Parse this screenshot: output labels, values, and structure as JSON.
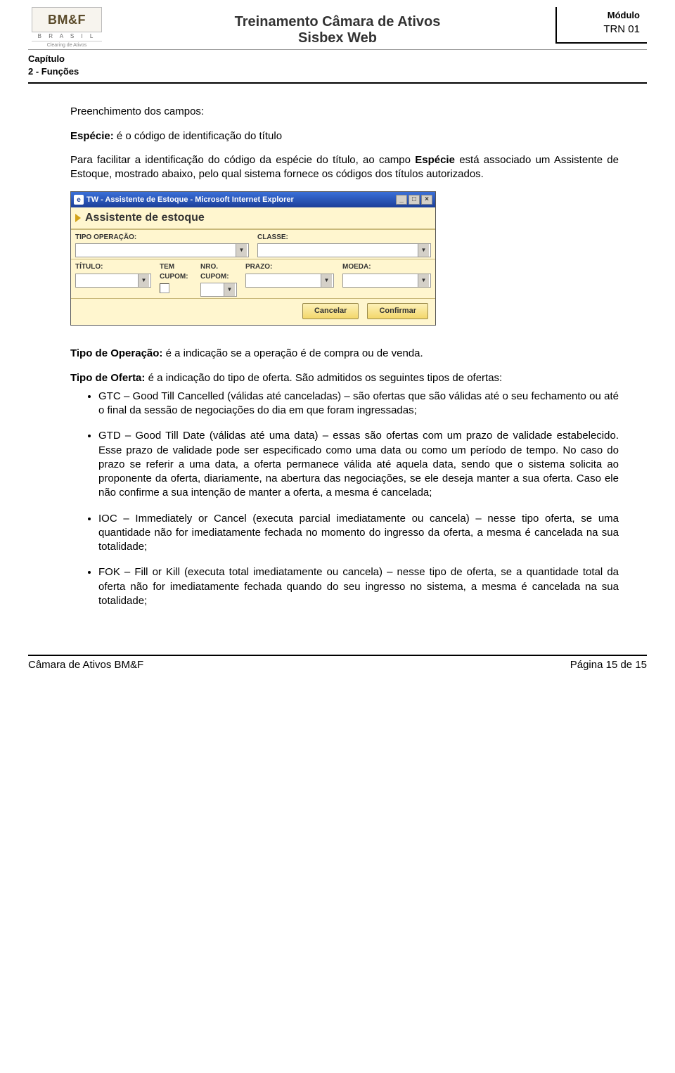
{
  "header": {
    "logo_main": "BM&F",
    "logo_country": "B R A S I L",
    "logo_sub": "Clearing de Ativos",
    "title_line1": "Treinamento Câmara de Ativos",
    "title_line2": "Sisbex Web",
    "modulo_label": "Módulo",
    "modulo_code": "TRN 01",
    "capitulo_label": "Capítulo",
    "capitulo_value": "2 - Funções"
  },
  "body": {
    "p1": "Preenchimento dos campos:",
    "especie_label": "Espécie:",
    "especie_text": " é o código de identificação do título",
    "p2_pre": "Para facilitar a identificação do código da espécie do título, ao campo ",
    "p2_bold": "Espécie",
    "p2_post": " está associado um Assistente de Estoque, mostrado abaixo, pelo qual sistema fornece os códigos dos títulos autorizados.",
    "tipo_op_label": "Tipo de Operação:",
    "tipo_op_text": " é a indicação se a operação é de compra ou de venda.",
    "tipo_oferta_label": "Tipo de Oferta:",
    "tipo_oferta_text": " é a indicação do tipo de oferta. São admitidos os seguintes tipos de ofertas:",
    "bullets": {
      "0": "GTC – Good Till Cancelled (válidas até canceladas) – são ofertas que são válidas até o seu fechamento ou até o final da sessão de negociações do dia em que foram ingressadas;",
      "1": "GTD – Good Till Date (válidas até uma data) – essas são ofertas com um prazo de validade estabelecido. Esse prazo de validade pode ser especificado como uma data ou como um período de tempo. No caso do prazo se referir a uma data, a oferta permanece válida até aquela data, sendo que o sistema solicita ao proponente da oferta, diariamente, na abertura das negociações, se ele deseja manter a sua oferta. Caso ele não confirme a sua intenção de manter a oferta, a mesma é cancelada;",
      "2": "IOC – Immediately or Cancel (executa parcial imediatamente ou cancela) – nesse tipo oferta, se uma quantidade não for imediatamente fechada no momento do ingresso da oferta, a mesma é cancelada na sua totalidade;",
      "3": "FOK – Fill or Kill (executa total imediatamente ou cancela) – nesse tipo de oferta, se a quantidade total da oferta não for imediatamente fechada quando do seu ingresso no sistema,  a mesma é cancelada na sua totalidade;"
    }
  },
  "win": {
    "title": "TW - Assistente de Estoque - Microsoft Internet Explorer",
    "panel_head": "Assistente de estoque",
    "labels": {
      "tipo_operacao": "TIPO OPERAÇÃO:",
      "classe": "CLASSE:",
      "titulo": "TÍTULO:",
      "tem_cupom": "TEM CUPOM:",
      "nro_cupom": "NRO. CUPOM:",
      "prazo": "PRAZO:",
      "moeda": "MOEDA:"
    },
    "buttons": {
      "cancel": "Cancelar",
      "confirm": "Confirmar"
    },
    "controls": {
      "min": "_",
      "max": "□",
      "close": "×"
    }
  },
  "footer": {
    "left": "Câmara de Ativos BM&F",
    "right": "Página 15 de 15"
  }
}
